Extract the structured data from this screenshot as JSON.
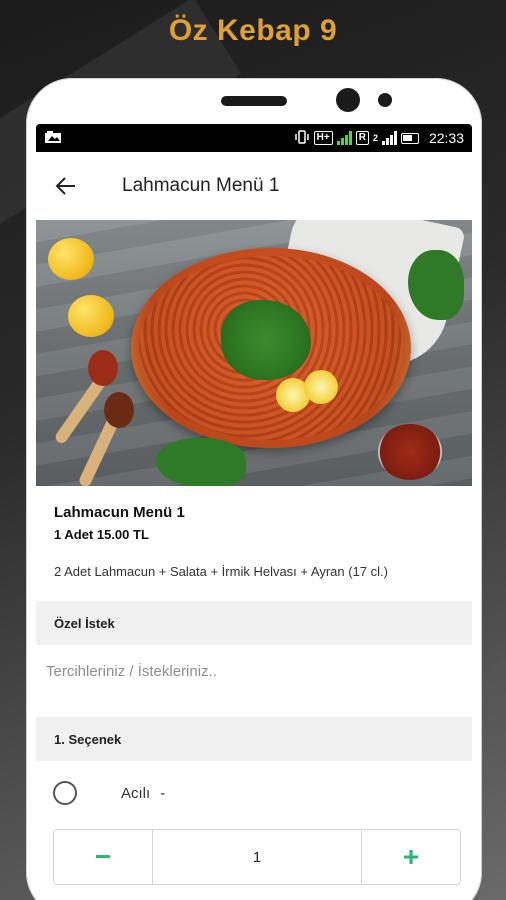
{
  "promo": {
    "title": "Öz Kebap 9"
  },
  "status_bar": {
    "net_type": "H+",
    "roaming": "R",
    "sim2": "2",
    "time": "22:33"
  },
  "app_bar": {
    "title": "Lahmacun Menü 1",
    "back_icon": "arrow-left-icon"
  },
  "item": {
    "name": "Lahmacun Menü 1",
    "quantity_price": "1 Adet  15.00 TL",
    "description": "2 Adet Lahmacun + Salata + İrmik Helvası + Ayran (17 cl.)"
  },
  "special_request": {
    "header": "Özel İstek",
    "placeholder": "Tercihleriniz / İstekleriniz.."
  },
  "options": {
    "header": "1. Seçenek",
    "items": [
      {
        "label": "Acılı",
        "price": "-"
      }
    ]
  },
  "stepper": {
    "minus": "−",
    "value": "1",
    "plus": "+"
  },
  "colors": {
    "accent": "#2bb673",
    "promo_title": "#e0a032"
  }
}
